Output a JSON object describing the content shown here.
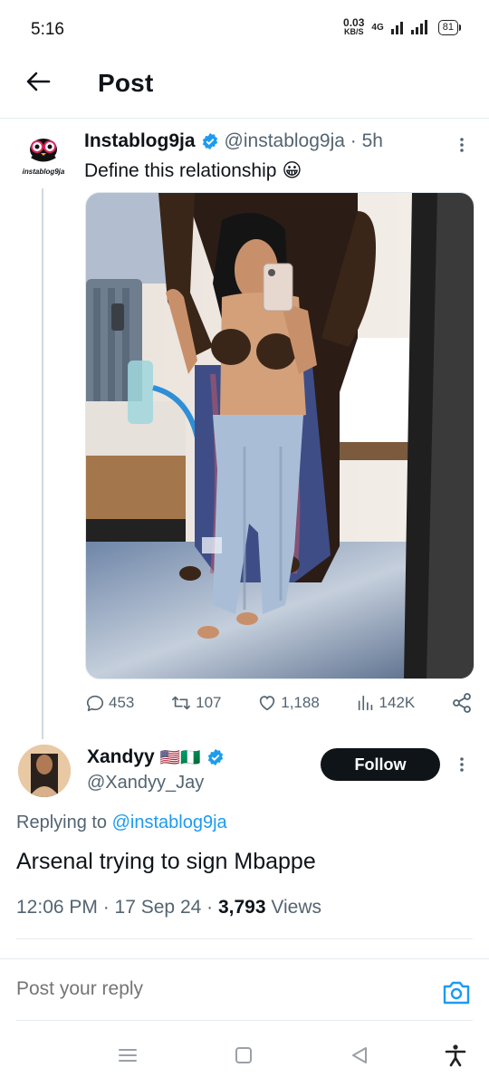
{
  "status": {
    "time": "5:16",
    "net_value": "0.03",
    "net_unit": "KB/S",
    "network_type": "4G",
    "battery": "81"
  },
  "header": {
    "title": "Post"
  },
  "tweet": {
    "name": "Instablog9ja",
    "handle": "@instablog9ja · 5h",
    "avatar_label": "instablog9ja",
    "text": "Define this relationship",
    "emoji": "😀",
    "stats": {
      "replies": "453",
      "reposts": "107",
      "likes": "1,188",
      "views": "142K"
    }
  },
  "reply": {
    "name": "Xandyy",
    "flags": "🇺🇸🇳🇬",
    "handle": "@Xandyy_Jay",
    "follow_label": "Follow",
    "replying_prefix": "Replying to",
    "replying_to": "@instablog9ja",
    "text": "Arsenal trying to sign Mbappe",
    "time": "12:06 PM · 17 Sep 24 · ",
    "views_count": "3,793",
    "views_label": " Views"
  },
  "composer": {
    "placeholder": "Post your reply"
  },
  "colors": {
    "accent": "#1d9bf0",
    "text": "#0f1419",
    "muted": "#536471"
  },
  "icons": [
    "back-arrow-icon",
    "verified-badge-icon",
    "more-vertical-icon",
    "reply-icon",
    "repost-icon",
    "like-icon",
    "views-icon",
    "share-icon",
    "camera-icon",
    "menu-icon",
    "home-icon",
    "back-icon",
    "accessibility-icon"
  ]
}
